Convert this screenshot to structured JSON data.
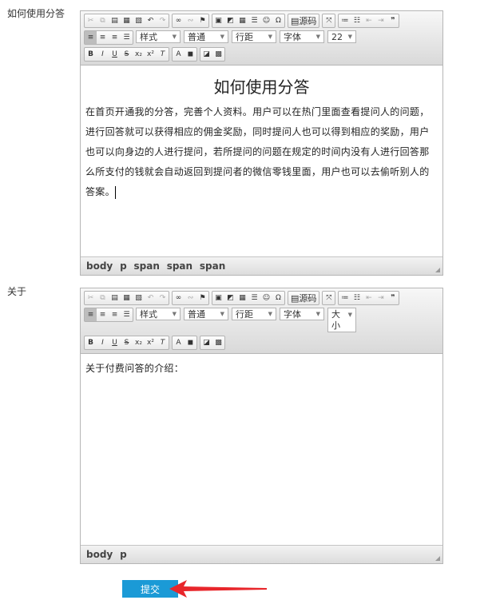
{
  "fields": [
    {
      "label": "如何使用分答",
      "toolbar": {
        "row1_group2_source": "源码",
        "style": "样式",
        "format": "普通",
        "line_height": "行距",
        "font": "字体",
        "size": "22"
      },
      "content": {
        "heading": "如何使用分答",
        "paragraph": "在首页开通我的分答，完善个人资料。用户可以在热门里面查看提问人的问题，进行回答就可以获得相应的佣金奖励，同时提问人也可以得到相应的奖励，用户也可以向身边的人进行提问，若所提问的问题在规定的时间内没有人进行回答那么所支付的钱就会自动返回到提问者的微信零钱里面，用户也可以去偷听别人的答案。"
      },
      "path": [
        "body",
        "p",
        "span",
        "span",
        "span"
      ]
    },
    {
      "label": "关于",
      "toolbar": {
        "row1_group2_source": "源码",
        "style": "样式",
        "format": "普通",
        "line_height": "行距",
        "font": "字体",
        "size": "大小"
      },
      "content": {
        "paragraph": "关于付费问答的介绍："
      },
      "path": [
        "body",
        "p"
      ]
    }
  ],
  "icons": {
    "row1": [
      "cut",
      "copy",
      "paste",
      "paste-text",
      "paste-word",
      "undo",
      "redo",
      "link",
      "unlink",
      "anchor",
      "image",
      "flash",
      "table",
      "hr",
      "smiley",
      "special-char",
      "source",
      "maximize",
      "numbered-list",
      "bulleted-list",
      "outdent",
      "indent",
      "blockquote"
    ],
    "row2": [
      "align-left",
      "align-center",
      "align-right",
      "justify"
    ],
    "row3": [
      "bold",
      "italic",
      "underline",
      "strike",
      "subscript",
      "superscript",
      "remove-format",
      "text-color",
      "bg-color",
      "insert-flash",
      "insert-image"
    ]
  },
  "submit_label": "提交",
  "colors": {
    "submit_bg": "#1b9ad6",
    "arrow": "#e8262b"
  }
}
